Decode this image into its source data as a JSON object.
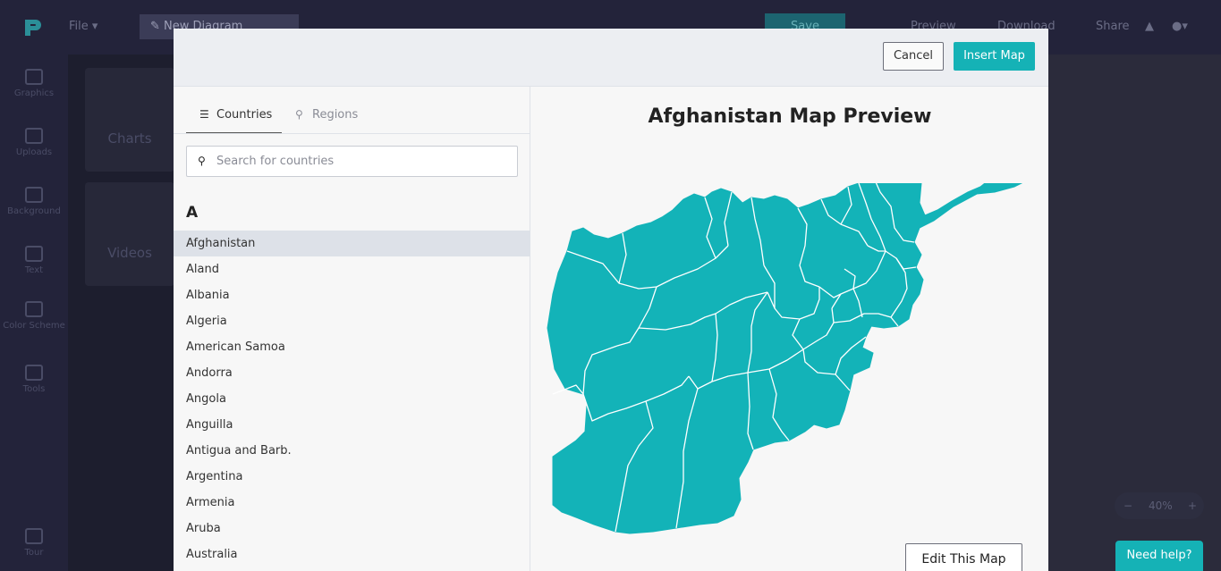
{
  "editor": {
    "file_menu": "File",
    "doc_title": "New Diagram",
    "save": "Save",
    "preview": "Preview",
    "download": "Download",
    "share": "Share",
    "sidebar": [
      "Graphics",
      "Uploads",
      "Background",
      "Text",
      "Color Scheme",
      "Tools",
      "Tour"
    ],
    "panel_cards": [
      "Charts",
      "Videos"
    ],
    "zoom": "40%"
  },
  "modal": {
    "cancel_label": "Cancel",
    "insert_label": "Insert Map",
    "tabs": [
      {
        "label": "Countries",
        "icon": "list-icon",
        "active": true
      },
      {
        "label": "Regions",
        "icon": "map-pin-icon",
        "active": false
      }
    ],
    "search_placeholder": "Search for countries",
    "letter_heading": "A",
    "countries": [
      "Afghanistan",
      "Aland",
      "Albania",
      "Algeria",
      "American Samoa",
      "Andorra",
      "Angola",
      "Anguilla",
      "Antigua and Barb.",
      "Argentina",
      "Armenia",
      "Aruba",
      "Australia"
    ],
    "selected_country": "Afghanistan",
    "preview_title": "Afghanistan Map Preview",
    "edit_label": "Edit This Map",
    "map_color": "#13b3b8"
  },
  "help": {
    "label": "Need help?"
  },
  "colors": {
    "accent": "#15b2b6",
    "selected_row": "#dde1e8"
  }
}
